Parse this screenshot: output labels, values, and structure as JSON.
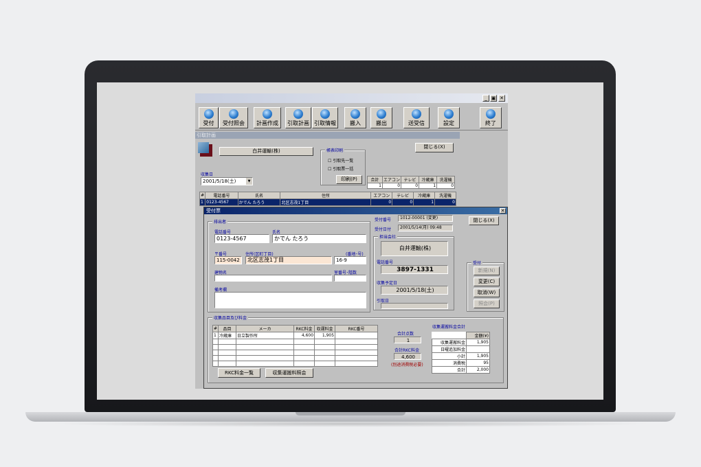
{
  "toolbar": {
    "buttons": [
      "受付",
      "受付照会",
      "計画作成",
      "引取計画",
      "引取情報",
      "搬入",
      "搬出",
      "送受信",
      "設定",
      "終了"
    ]
  },
  "window_controls": [
    "_",
    "▣",
    "✕"
  ],
  "plan_window": {
    "title": "引取計画",
    "company_button": "白井運輸(株)",
    "print_group": "帳表印刷",
    "print_options": [
      "引取先一覧",
      "引取票一括"
    ],
    "print_button": "印刷(P)",
    "close_button": "閉じる(X)",
    "collect_date_label": "収集日",
    "collect_date": "2001/5/18(土)",
    "totals_headers": [
      "合計",
      "エアコン",
      "テレビ",
      "冷蔵庫",
      "洗濯機"
    ],
    "totals_values": [
      "1",
      "0",
      "0",
      "1",
      "0"
    ],
    "list_headers": [
      "#",
      "電話番号",
      "氏名",
      "住所",
      "エアコン",
      "テレビ",
      "冷蔵庫",
      "洗濯機"
    ],
    "list_row": [
      "1",
      "0123-4567",
      "かでん たろう",
      "北区志茂1丁目",
      "0",
      "0",
      "1",
      "0"
    ]
  },
  "reception_window": {
    "title": "受付票",
    "close_button": "閉じる(X)",
    "applicant_group": "排出者",
    "phone_label": "電話番号",
    "phone": "0123-4567",
    "name_label": "氏名",
    "name": "かでん たろう",
    "zip_label": "〒番号",
    "zip": "115-0042",
    "address_label": "住所(区町丁目)",
    "address": "北区志茂1丁目",
    "number_label": "(番地･号)",
    "number": "16-9",
    "building_label": "建物名",
    "building": "",
    "room_label": "室番号･階数",
    "room": "",
    "remarks_label": "備考欄",
    "remarks": "",
    "receipt_no_label": "受付番号",
    "receipt_no": "1012-00001 (変更)",
    "receipt_date_label": "受付日付",
    "receipt_date": "2001/5/14(月) 09:48",
    "agent_group": "担当会社",
    "agent": "白井運輸(株)",
    "agent_phone_label": "電話番号",
    "agent_phone": "3897-1331",
    "plan_date_label": "収集予定日",
    "plan_date": "2001/5/18(土)",
    "pickup_date_label": "引取日",
    "pickup_date": "",
    "actions_group": "受付",
    "actions": [
      "新規(N)",
      "変更(C)",
      "取消(W)",
      "照会(P)"
    ],
    "items_group": "収集品目及び料金",
    "items_headers": [
      "#",
      "品目",
      "メーカ",
      "RKC料金",
      "収運料金",
      "RKC番号"
    ],
    "items_rows": [
      [
        "1",
        "冷蔵庫",
        "日立製作所",
        "4,600",
        "1,905",
        ""
      ]
    ],
    "count_label": "合計点数",
    "count": "1",
    "rkc_total_label": "合計RKC料金",
    "rkc_total": "4,600",
    "rkc_note": "(別途消費税必要)",
    "fee_group": "収集運搬料金合計",
    "fee_header": "金額(¥)",
    "fee_rows": [
      [
        "収集運搬料金",
        "1,905"
      ],
      [
        "日曜追加料金",
        ""
      ],
      [
        "小計",
        "1,905"
      ],
      [
        "消費税",
        "95"
      ],
      [
        "合計",
        "2,000"
      ]
    ],
    "btn_rkc_list": "RKC料金一覧",
    "btn_fee_ref": "収集運搬料照会"
  }
}
